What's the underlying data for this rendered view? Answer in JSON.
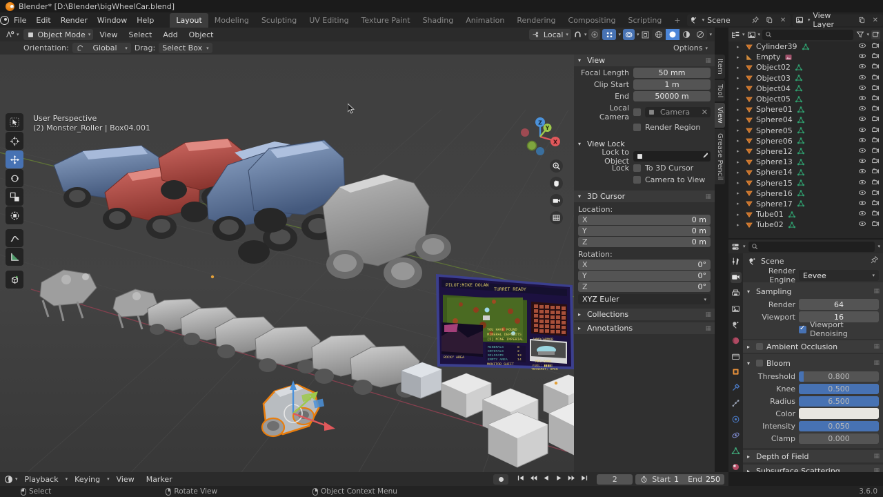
{
  "window": {
    "title": "Blender* [D:\\Blender\\bigWheelCar.blend]",
    "logo": "blender-logo",
    "version": "3.6.0"
  },
  "topbar": {
    "menus": [
      "File",
      "Edit",
      "Render",
      "Window",
      "Help"
    ],
    "workspace_tabs": [
      {
        "label": "Layout",
        "active": true
      },
      {
        "label": "Modeling",
        "active": false
      },
      {
        "label": "Sculpting",
        "active": false
      },
      {
        "label": "UV Editing",
        "active": false
      },
      {
        "label": "Texture Paint",
        "active": false
      },
      {
        "label": "Shading",
        "active": false
      },
      {
        "label": "Animation",
        "active": false
      },
      {
        "label": "Rendering",
        "active": false
      },
      {
        "label": "Compositing",
        "active": false
      },
      {
        "label": "Scripting",
        "active": false
      }
    ],
    "add_tab_label": "+",
    "scene_name": "Scene",
    "view_layer_name": "View Layer"
  },
  "viewport_header": {
    "editor_type_icon": "editor-type-icon",
    "mode": "Object Mode",
    "menus": [
      "View",
      "Select",
      "Add",
      "Object"
    ],
    "transform_orientation": "Local",
    "snap_icon": "magnet-icon",
    "proportional_icon": "proportional-editing-icon",
    "shading_modes": [
      "wireframe",
      "solid",
      "material-preview",
      "rendered"
    ]
  },
  "tool_settings": {
    "orientation_label": "Orientation:",
    "orientation_value": "Global",
    "drag_label": "Drag:",
    "drag_value": "Select Box",
    "options_label": "Options"
  },
  "viewport": {
    "overlay_line1": "User Perspective",
    "overlay_line2": "(2) Monster_Roller | Box04.001",
    "gizmo_axes": [
      {
        "label": "X",
        "color": "#e0585b"
      },
      {
        "label": "Y",
        "color": "#9ec94b"
      },
      {
        "label": "Z",
        "color": "#4b92db"
      }
    ],
    "toolbar_tools": [
      "tweak-select-tool",
      "cursor-tool",
      "move-tool",
      "rotate-tool",
      "scale-tool",
      "transform-tool",
      "annotate-tool",
      "measure-tool",
      "add-cube-tool"
    ],
    "nav_buttons": [
      "zoom-icon",
      "pan-hand-icon",
      "camera-view-icon",
      "ortho-persp-icon"
    ],
    "selected_tool": "move-tool"
  },
  "sidebar": {
    "tabs": [
      {
        "label": "Item",
        "active": false
      },
      {
        "label": "Tool",
        "active": false
      },
      {
        "label": "View",
        "active": true
      },
      {
        "label": "Grease Pencil",
        "active": false
      }
    ],
    "view_panel": {
      "title": "View",
      "focal_length_label": "Focal Length",
      "focal_length_value": "50 mm",
      "clip_start_label": "Clip Start",
      "clip_start_value": "1 m",
      "clip_end_label": "End",
      "clip_end_value": "50000 m",
      "local_camera_label": "Local Camera",
      "local_camera_value": "Camera",
      "render_region_label": "Render Region",
      "render_region_checked": false
    },
    "view_lock_panel": {
      "title": "View Lock",
      "lock_to_object_label": "Lock to Object",
      "lock_to_object_value": "",
      "lock_label": "Lock",
      "to_3d_cursor_label": "To 3D Cursor",
      "to_3d_cursor_checked": false,
      "camera_to_view_label": "Camera to View",
      "camera_to_view_checked": false
    },
    "cursor_panel": {
      "title": "3D Cursor",
      "location_label": "Location:",
      "location": [
        {
          "axis": "X",
          "value": "0 m"
        },
        {
          "axis": "Y",
          "value": "0 m"
        },
        {
          "axis": "Z",
          "value": "0 m"
        }
      ],
      "rotation_label": "Rotation:",
      "rotation": [
        {
          "axis": "X",
          "value": "0°"
        },
        {
          "axis": "Y",
          "value": "0°"
        },
        {
          "axis": "Z",
          "value": "0°"
        }
      ],
      "rotation_mode": "XYZ Euler"
    },
    "collapsed_panels": [
      "Collections",
      "Annotations"
    ]
  },
  "outliner": {
    "display_mode_icon": "outliner-display-mode-icon",
    "filter_icon": "filter-icon",
    "new_collection_icon": "new-collection-icon",
    "search_placeholder": "",
    "items": [
      {
        "name": "Cylinder39",
        "type": "mesh"
      },
      {
        "name": "Empty",
        "type": "image-empty"
      },
      {
        "name": "Object02",
        "type": "mesh"
      },
      {
        "name": "Object03",
        "type": "mesh"
      },
      {
        "name": "Object04",
        "type": "mesh"
      },
      {
        "name": "Object05",
        "type": "mesh"
      },
      {
        "name": "Sphere01",
        "type": "mesh"
      },
      {
        "name": "Sphere04",
        "type": "mesh"
      },
      {
        "name": "Sphere05",
        "type": "mesh"
      },
      {
        "name": "Sphere06",
        "type": "mesh"
      },
      {
        "name": "Sphere12",
        "type": "mesh"
      },
      {
        "name": "Sphere13",
        "type": "mesh"
      },
      {
        "name": "Sphere14",
        "type": "mesh"
      },
      {
        "name": "Sphere15",
        "type": "mesh"
      },
      {
        "name": "Sphere16",
        "type": "mesh"
      },
      {
        "name": "Sphere17",
        "type": "mesh"
      },
      {
        "name": "Tube01",
        "type": "mesh"
      },
      {
        "name": "Tube02",
        "type": "mesh"
      }
    ]
  },
  "properties": {
    "breadcrumb": "Scene",
    "render_engine_label": "Render Engine",
    "render_engine_value": "Eevee",
    "sampling": {
      "title": "Sampling",
      "render_label": "Render",
      "render_value": "64",
      "viewport_label": "Viewport",
      "viewport_value": "16",
      "denoise_label": "Viewport Denoising",
      "denoise_checked": true
    },
    "ambient_occlusion": {
      "title": "Ambient Occlusion",
      "enabled": false
    },
    "bloom": {
      "title": "Bloom",
      "enabled": false,
      "threshold_label": "Threshold",
      "threshold_value": "0.800",
      "threshold_fill": 6,
      "knee_label": "Knee",
      "knee_value": "0.500",
      "knee_fill": 100,
      "radius_label": "Radius",
      "radius_value": "6.500",
      "radius_fill": 100,
      "color_label": "Color",
      "color_value": "#e8e6e1",
      "intensity_label": "Intensity",
      "intensity_value": "0.050",
      "intensity_fill": 100,
      "clamp_label": "Clamp",
      "clamp_value": "0.000",
      "clamp_fill": 0
    },
    "depth_of_field": {
      "title": "Depth of Field"
    },
    "subsurface_scattering": {
      "title": "Subsurface Scattering"
    },
    "tab_icons": [
      "tool-icon",
      "render-icon",
      "output-icon",
      "view-layer-icon",
      "scene-icon",
      "world-icon",
      "collection-icon",
      "object-icon",
      "modifier-icon",
      "particles-icon",
      "physics-icon",
      "constraints-icon",
      "data-icon",
      "material-icon"
    ]
  },
  "timeline": {
    "editor_icon": "timeline-editor-icon",
    "menus": [
      "Playback",
      "Keying",
      "View",
      "Marker"
    ],
    "current_frame": "2",
    "start_label": "Start",
    "start_value": "1",
    "end_label": "End",
    "end_value": "250",
    "auto_key_icon": "record-icon",
    "transport": [
      "jump-to-start",
      "prev-keyframe",
      "play-reverse",
      "play",
      "next-keyframe",
      "jump-to-end"
    ]
  },
  "statusbar": {
    "hints": [
      {
        "mouse": "left",
        "label": "Select"
      },
      {
        "mouse": "middle",
        "label": "Rotate View"
      },
      {
        "mouse": "right",
        "label": "Object Context Menu"
      }
    ],
    "version": "3.6.0"
  }
}
